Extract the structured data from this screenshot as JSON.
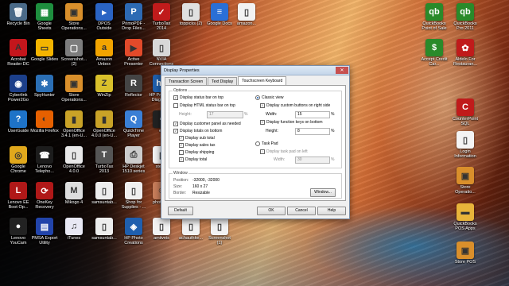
{
  "desktop_icons": [
    {
      "label": "Recycle Bin",
      "icon": "recycle-bin-icon",
      "color": "#4a6a88",
      "glyph": "🗑"
    },
    {
      "label": "Acrobat Reader DC",
      "icon": "acrobat-icon",
      "color": "#c4161c",
      "glyph": "A"
    },
    {
      "label": "Cyberlink Power2Go",
      "icon": "cyberlink-icon",
      "color": "#1c3f8a",
      "glyph": "◉"
    },
    {
      "label": "UserGuide",
      "icon": "userguide-icon",
      "color": "#1e73c8",
      "glyph": "?"
    },
    {
      "label": "Google Chrome",
      "icon": "chrome-icon",
      "color": "#e0a81c",
      "glyph": "◎"
    },
    {
      "label": "Lenovo EE Boot Op...",
      "icon": "lenovo-boot-icon",
      "color": "#b01818",
      "glyph": "L"
    },
    {
      "label": "Lenovo YouCam",
      "icon": "youcam-icon",
      "color": "#222222",
      "glyph": "●"
    },
    {
      "label": "Google Sheets",
      "icon": "sheets-icon",
      "color": "#1e8e3e",
      "glyph": "▦"
    },
    {
      "label": "Google Slides",
      "icon": "slides-icon",
      "color": "#f4b400",
      "glyph": "▭"
    },
    {
      "label": "SpyHunter",
      "icon": "spyhunter-icon",
      "color": "#2b6fb5",
      "glyph": "✱"
    },
    {
      "label": "Mozilla Firefox",
      "icon": "firefox-icon",
      "color": "#e66000",
      "glyph": "◐"
    },
    {
      "label": "Lenovo Telepho...",
      "icon": "telephony-icon",
      "color": "#1c1c1c",
      "glyph": "☎"
    },
    {
      "label": "OneKey Recovery",
      "icon": "onekey-icon",
      "color": "#b01818",
      "glyph": "⟳"
    },
    {
      "label": "PMSA Export Utility",
      "icon": "pmsa-icon",
      "color": "#2244aa",
      "glyph": "▤"
    },
    {
      "label": "Store Operations...",
      "icon": "store-ops-icon",
      "color": "#d98f2b",
      "glyph": "▣"
    },
    {
      "label": "Screenshot... (2)",
      "icon": "screenshot-icon",
      "color": "#7d7d7d",
      "glyph": "▢"
    },
    {
      "label": "Store Operations...",
      "icon": "store-ops-icon",
      "color": "#d98f2b",
      "glyph": "▣"
    },
    {
      "label": "OpenOffice 3.4.1 (en-U...",
      "icon": "openoffice-icon",
      "color": "#c9a227",
      "glyph": "▮"
    },
    {
      "label": "OpenOffice 4.0.0",
      "icon": "openoffice-icon",
      "color": "#e8e8e8",
      "glyph": "▯"
    },
    {
      "label": "Mikogo 4",
      "icon": "mikogo-icon",
      "color": "#dddddd",
      "glyph": "M"
    },
    {
      "label": "iTunes",
      "icon": "itunes-icon",
      "color": "#e8e8f4",
      "glyph": "♫"
    },
    {
      "label": "DPOS Outside",
      "icon": "dpos-icon",
      "color": "#2a64c4",
      "glyph": "▸"
    },
    {
      "label": "Amazon Unbox",
      "icon": "amazon-icon",
      "color": "#f2a400",
      "glyph": "a"
    },
    {
      "label": "WinZip",
      "icon": "winzip-icon",
      "color": "#d9c02b",
      "glyph": "Z"
    },
    {
      "label": "OpenOffice 4.0.0 (en-U...",
      "icon": "openoffice-icon",
      "color": "#c9a227",
      "glyph": "▮"
    },
    {
      "label": "TurboTax 2013",
      "icon": "turbotax-icon",
      "color": "#555555",
      "glyph": "T"
    },
    {
      "label": "samsuntab...",
      "icon": "file-icon",
      "color": "#ededed",
      "glyph": "▯"
    },
    {
      "label": "samsuntab...",
      "icon": "file-icon",
      "color": "#ededed",
      "glyph": "▯"
    },
    {
      "label": "PrimoPDF - Drop Files...",
      "icon": "primopdf-icon",
      "color": "#2d6ab4",
      "glyph": "P"
    },
    {
      "label": "Active Presenter",
      "icon": "activepresenter-icon",
      "color": "#e24a2a",
      "glyph": "▶"
    },
    {
      "label": "Reflector",
      "icon": "reflector-icon",
      "color": "#444444",
      "glyph": "R"
    },
    {
      "label": "QuickTime Player",
      "icon": "quicktime-icon",
      "color": "#3a7fd5",
      "glyph": "Q"
    },
    {
      "label": "HP Deskjet 1510 series",
      "icon": "printer-icon",
      "color": "#cccccc",
      "glyph": "⎙"
    },
    {
      "label": "Shop for Supplies - ...",
      "icon": "shop-icon",
      "color": "#f0f0f0",
      "glyph": "▯"
    },
    {
      "label": "HP Photo Creations",
      "icon": "hp-photo-icon",
      "color": "#1f5fae",
      "glyph": "◈"
    },
    {
      "label": "TurboTax 2014",
      "icon": "turbotax-icon",
      "color": "#c01b1b",
      "glyph": "✓"
    },
    {
      "label": "NVIA Connections",
      "icon": "nvia-icon",
      "color": "#d8d8d8",
      "glyph": "▯"
    },
    {
      "label": "HP Print and Diagnos...",
      "icon": "hp-print-icon",
      "color": "#1f5fae",
      "glyph": "hp"
    },
    {
      "label": "e3",
      "icon": "file-icon",
      "color": "#222222",
      "glyph": "▪"
    },
    {
      "label": "steve!",
      "icon": "file-icon",
      "color": "#f2f2f2",
      "glyph": "▯"
    },
    {
      "label": "photo (1)",
      "icon": "photo-icon",
      "color": "#c77d5a",
      "glyph": "☺"
    },
    {
      "label": "amiiveis",
      "icon": "file-icon",
      "color": "#f2f2f2",
      "glyph": "▯"
    },
    {
      "label": "toppicks (2)",
      "icon": "file-icon",
      "color": "#e0e0e0",
      "glyph": "▯"
    },
    {
      "label": "cloudfront2",
      "icon": "file-icon",
      "color": "#f2f2f2",
      "glyph": "▯"
    },
    {
      "label": "achauthke...",
      "icon": "file-icon",
      "color": "#f2f2f2",
      "glyph": "▯"
    },
    {
      "label": "Google Docs",
      "icon": "docs-icon",
      "color": "#2a6fd6",
      "glyph": "≡"
    },
    {
      "label": "gwenbcmnd",
      "icon": "file-icon",
      "color": "#f2f2f2",
      "glyph": "▯"
    },
    {
      "label": "Screenshot (1)",
      "icon": "screenshot-icon",
      "color": "#f2f2f2",
      "glyph": "▯"
    },
    {
      "label": "amazon...",
      "icon": "file-icon",
      "color": "#f2f2f2",
      "glyph": "▯"
    }
  ],
  "right_icons": [
    {
      "label": "QuickBooks Point of Sale",
      "icon": "quickbooks-icon",
      "color": "#2a8a2a",
      "glyph": "qb"
    },
    {
      "label": "Accept Credit Car...",
      "icon": "credit-card-icon",
      "color": "#2a8a2a",
      "glyph": "$"
    },
    {
      "label": "QuickBooks Pro 2011",
      "icon": "quickbooks-icon",
      "color": "#2a8a2a",
      "glyph": "qb"
    },
    {
      "label": "Aldelo For Restauran...",
      "icon": "aldelo-icon",
      "color": "#c01b1b",
      "glyph": "✿"
    },
    {
      "label": "CounterPoint SQL",
      "icon": "counterpoint-icon",
      "color": "#c01b1b",
      "glyph": "C"
    },
    {
      "label": "Login Information",
      "icon": "document-icon",
      "color": "#f4f4f4",
      "glyph": "▯"
    },
    {
      "label": "Store Operatio...",
      "icon": "store-ops-icon",
      "color": "#d98f2b",
      "glyph": "▣"
    },
    {
      "label": "QuickBooks POS Apps",
      "icon": "folder-icon",
      "color": "#e8b43a",
      "glyph": "▬"
    },
    {
      "label": "Store POS",
      "icon": "store-pos-icon",
      "color": "#d98f2b",
      "glyph": "▣"
    }
  ],
  "dialog": {
    "title": "Display Properties",
    "close": "✕",
    "tabs": [
      "Transaction Screen",
      "Text Display",
      "Touchscreen Keyboard"
    ],
    "options_title": "Options",
    "display_status_bar": "Display status bar on top",
    "display_html_status": "Display HTML status bar on top",
    "height_label": "Height:",
    "height_value": "17",
    "height_unit": "%",
    "display_custom_panel": "Display customer panel as needed",
    "display_totals": "Display totals on bottom",
    "display_sub_total": "Display sub total",
    "display_sales_tax": "Display sales tax",
    "display_shipping": "Display shipping",
    "display_total": "Display total",
    "classic_view": "Classic view",
    "display_custom_buttons": "Display custom buttons on right side",
    "width_label": "Width:",
    "width_value": "15",
    "width_unit": "%",
    "display_function_keys": "Display function keys on bottom",
    "height2_label": "Height:",
    "height2_value": "8",
    "height2_unit": "%",
    "task_pad": "Task Pad",
    "display_task_pad": "Display task pad on left",
    "width2_label": "Width:",
    "width2_value": "30",
    "width2_unit": "%",
    "window_title": "Window",
    "position_label": "Position:",
    "position_value": "-32000, -32000",
    "size_label": "Size:",
    "size_value": "160 x 27",
    "border_label": "Border:",
    "border_value": "Resizable",
    "window_button": "Window...",
    "default_button": "Default",
    "ok_button": "OK",
    "cancel_button": "Cancel",
    "help_button": "Help"
  }
}
